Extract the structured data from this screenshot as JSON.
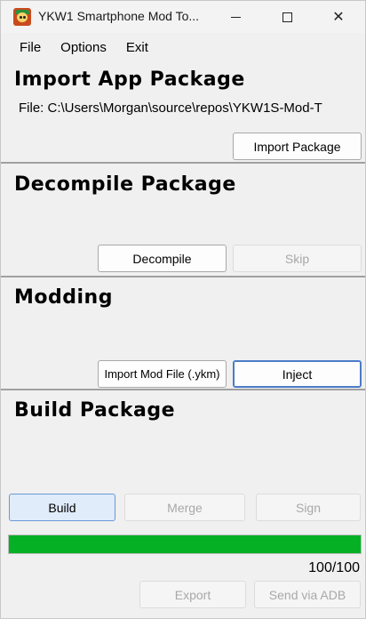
{
  "window": {
    "title": "YKW1 Smartphone Mod To...",
    "minimize_icon": "minimize-icon",
    "maximize_icon": "maximize-icon",
    "close_glyph": "✕"
  },
  "menu": [
    "File",
    "Options",
    "Exit"
  ],
  "import_section": {
    "heading": "Import App Package",
    "file_label": "File:",
    "file_path": "C:\\Users\\Morgan\\source\\repos\\YKW1S-Mod-T",
    "import_button": "Import Package"
  },
  "decompile_section": {
    "heading": "Decompile Package",
    "decompile_button": "Decompile",
    "skip_button": "Skip"
  },
  "modding_section": {
    "heading": "Modding",
    "import_mod_button": "Import Mod File (.ykm)",
    "inject_button": "Inject"
  },
  "build_section": {
    "heading": "Build Package",
    "build_button": "Build",
    "merge_button": "Merge",
    "sign_button": "Sign"
  },
  "progress": {
    "value": 100,
    "max": 100,
    "label": "100/100",
    "color": "#06b025"
  },
  "footer": {
    "export_button": "Export",
    "send_button": "Send via ADB"
  }
}
